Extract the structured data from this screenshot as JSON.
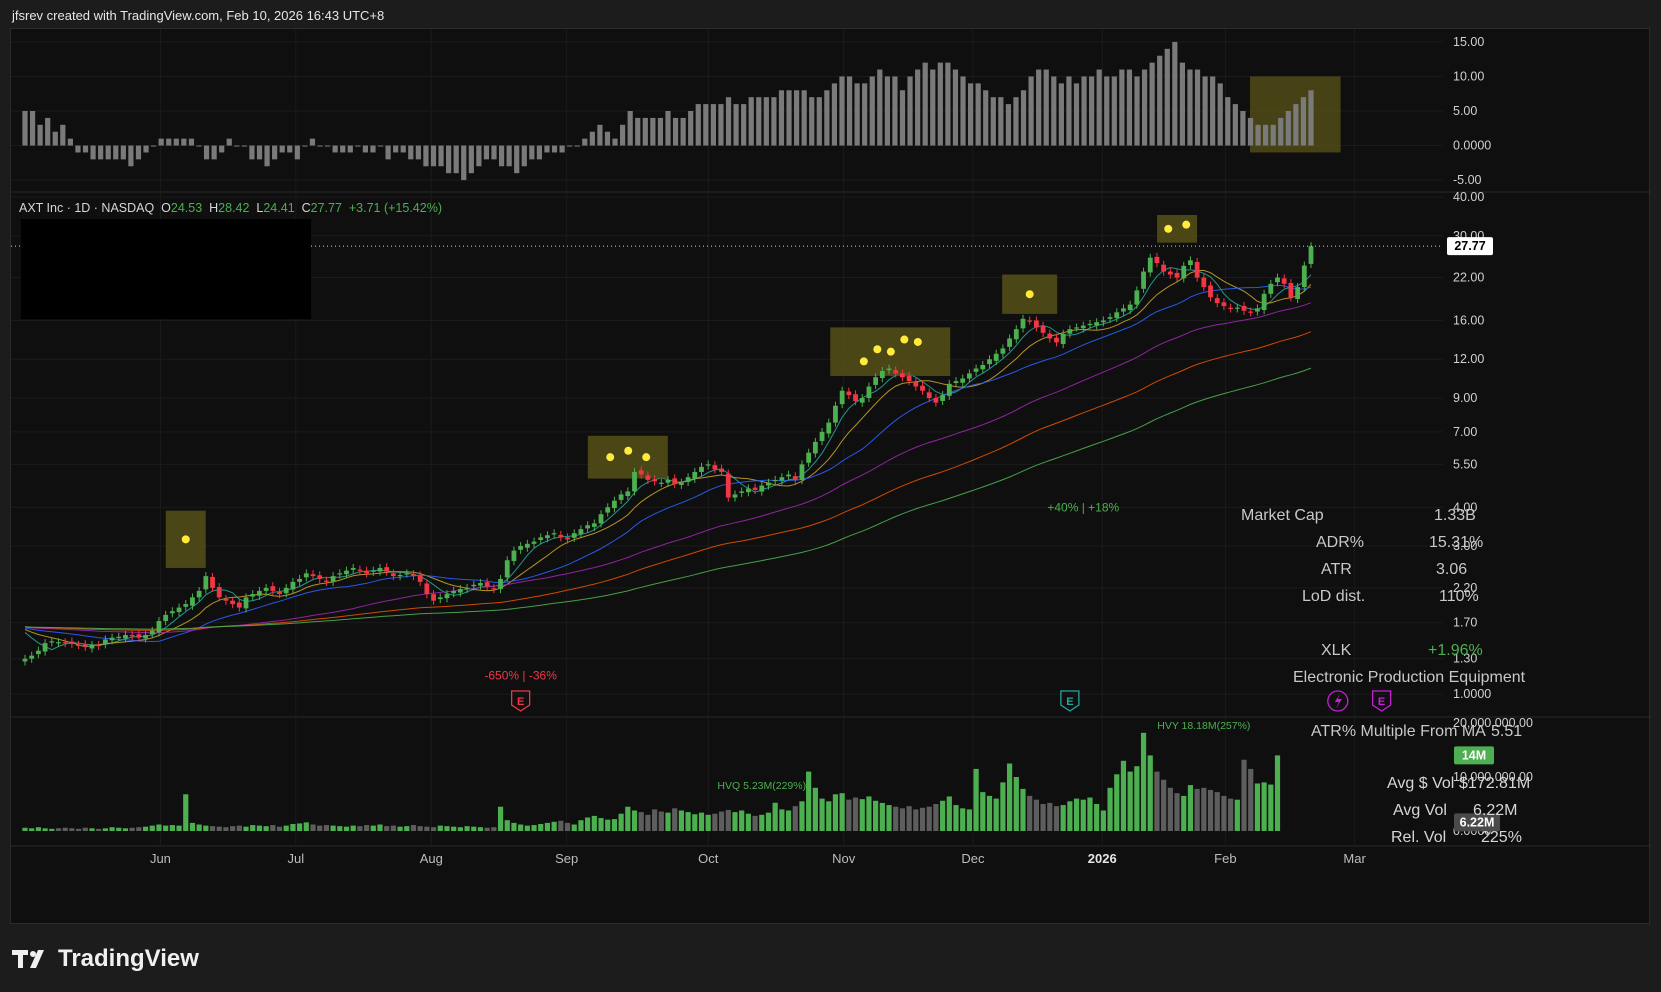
{
  "header": {
    "created_line": "jfsrev created with TradingView.com, Feb 10, 2026 16:43 UTC+8"
  },
  "brand": {
    "name": "TradingView"
  },
  "legend": {
    "symbol": "AXT Inc · 1D · NASDAQ",
    "open_label": "O",
    "open": "24.53",
    "high_label": "H",
    "high": "28.42",
    "low_label": "L",
    "low": "24.41",
    "close_label": "C",
    "close": "27.77",
    "change": "+3.71 (+15.42%)"
  },
  "last_price_tag": "27.77",
  "stats": {
    "market_cap_label": "Market Cap",
    "market_cap": "1.33B",
    "adr_label": "ADR%",
    "adr": "15.31%",
    "atr_label": "ATR",
    "atr": "3.06",
    "lod_label": "LoD dist.",
    "lod": "110%",
    "sector_etf_label": "XLK",
    "sector_etf_change": "+1.96%",
    "industry": "Electronic Production Equipment",
    "atr_multiple_label": "ATR% Multiple From MA",
    "atr_multiple": "5.51"
  },
  "volume_stats": {
    "avg_dollar_vol_label": "Avg $ Vol",
    "avg_dollar_vol": "$172.81M",
    "avg_vol_label": "Avg Vol",
    "avg_vol": "6.22M",
    "rel_vol_label": "Rel. Vol",
    "rel_vol": "225%",
    "tag_green": "14M",
    "tag_gray": "6.22M"
  },
  "annotations": {
    "earnings_neg": "-650% | -36%",
    "earnings_pos": "+40% | +18%",
    "hvq": "HVQ 5.23M(229%)",
    "hvy": "HVY 18.18M(257%)"
  },
  "colors": {
    "up": "#4caf50",
    "down": "#f23645",
    "background": "#0f0f0f",
    "highlight": "#5a5418",
    "dot": "#ffeb3b",
    "ma_fast": "#26a69a",
    "ma_10": "#c9a227",
    "ma_21": "#2962ff",
    "ma_50": "#9c27b0",
    "ma_100": "#e65100",
    "ma_200": "#4caf50"
  },
  "chart_data": [
    {
      "type": "bar",
      "title": "",
      "yticks": [
        "15.00",
        "10.00",
        "5.00",
        "0.0000",
        "-5.00"
      ],
      "ylim": [
        -6,
        16
      ],
      "values": [
        5,
        5,
        3,
        4,
        2,
        3,
        1,
        -1,
        -1,
        -2,
        -2,
        -2,
        -2,
        -2,
        -3,
        -2,
        -1,
        0,
        1,
        1,
        1,
        1,
        1,
        0,
        -2,
        -2,
        -1,
        1,
        0,
        0,
        -2,
        -2,
        -3,
        -2,
        -1,
        -1,
        -2,
        0,
        1,
        0,
        0,
        -1,
        -1,
        -1,
        0,
        -1,
        -1,
        0,
        -2,
        -1,
        -1,
        -2,
        -2,
        -3,
        -3,
        -3,
        -4,
        -4,
        -5,
        -4,
        -3,
        -2,
        -2,
        -3,
        -3,
        -4,
        -3,
        -2,
        -2,
        -1,
        -1,
        -1,
        0,
        0,
        1,
        2,
        3,
        2,
        1,
        3,
        5,
        4,
        4,
        4,
        4,
        5,
        4,
        4,
        5,
        6,
        6,
        6,
        6,
        7,
        6,
        6,
        7,
        7,
        7,
        7,
        8,
        8,
        8,
        8,
        7,
        7,
        8,
        9,
        10,
        10,
        9,
        9,
        10,
        11,
        10,
        10,
        8,
        10,
        11,
        12,
        11,
        12,
        12,
        11,
        10,
        9,
        9,
        8,
        7,
        7,
        6,
        7,
        8,
        10,
        11,
        11,
        10,
        9,
        10,
        9,
        10,
        10,
        11,
        10,
        10,
        11,
        11,
        10,
        11,
        12,
        13,
        14,
        15,
        12,
        11,
        11,
        10,
        10,
        9,
        7,
        6,
        5,
        4,
        3,
        3,
        3,
        4,
        5,
        6,
        7,
        8
      ],
      "highlight_last": 8
    },
    {
      "type": "candlestick",
      "title": "AXT Inc · 1D · NASDAQ",
      "xticks": [
        "Jun",
        "Jul",
        "Aug",
        "Sep",
        "Oct",
        "Nov",
        "Dec",
        "2026",
        "Feb",
        "Mar"
      ],
      "yticks": [
        "40.00",
        "30.00",
        "22.00",
        "16.00",
        "12.00",
        "9.00",
        "7.00",
        "5.50",
        "4.00",
        "3.00",
        "2.20",
        "1.70",
        "1.30",
        "1.0000"
      ],
      "yscale": "log",
      "ylim": [
        0.95,
        40
      ],
      "closes": [
        1.3,
        1.33,
        1.38,
        1.46,
        1.48,
        1.47,
        1.46,
        1.45,
        1.44,
        1.42,
        1.44,
        1.43,
        1.5,
        1.52,
        1.53,
        1.55,
        1.54,
        1.52,
        1.55,
        1.6,
        1.72,
        1.8,
        1.85,
        1.9,
        1.95,
        2.05,
        2.15,
        2.4,
        2.2,
        2.05,
        2.0,
        1.95,
        1.9,
        2.05,
        2.1,
        2.15,
        2.2,
        2.15,
        2.1,
        2.2,
        2.3,
        2.35,
        2.45,
        2.4,
        2.35,
        2.3,
        2.4,
        2.45,
        2.5,
        2.55,
        2.5,
        2.45,
        2.5,
        2.55,
        2.48,
        2.4,
        2.42,
        2.45,
        2.4,
        2.3,
        2.1,
        2.0,
        2.05,
        2.1,
        2.15,
        2.18,
        2.2,
        2.25,
        2.28,
        2.22,
        2.18,
        2.35,
        2.7,
        2.9,
        3.0,
        3.05,
        3.1,
        3.2,
        3.25,
        3.3,
        3.2,
        3.15,
        3.3,
        3.4,
        3.5,
        3.55,
        3.8,
        4.0,
        4.2,
        4.4,
        4.5,
        5.2,
        5.1,
        4.9,
        4.85,
        4.8,
        4.9,
        4.75,
        4.8,
        5.0,
        5.2,
        5.4,
        5.5,
        5.3,
        5.2,
        4.3,
        4.4,
        4.5,
        4.6,
        4.55,
        4.7,
        4.8,
        4.9,
        5.0,
        5.1,
        4.9,
        5.5,
        6.0,
        6.5,
        7.0,
        7.5,
        8.5,
        9.5,
        9.2,
        8.8,
        9.0,
        9.8,
        10.5,
        11.0,
        11.2,
        10.8,
        10.5,
        10.2,
        9.8,
        9.5,
        9.0,
        8.7,
        9.2,
        10.0,
        10.2,
        10.4,
        10.8,
        11.2,
        11.5,
        12.0,
        12.5,
        13.0,
        14.0,
        15.0,
        16.2,
        16.0,
        15.2,
        14.6,
        14.0,
        13.6,
        14.5,
        15.0,
        15.2,
        15.4,
        15.6,
        15.8,
        16.0,
        16.4,
        17.0,
        17.5,
        18.0,
        20.0,
        23.0,
        25.5,
        24.5,
        23.0,
        22.5,
        22.0,
        24.0,
        25.0,
        22.0,
        20.5,
        19.0,
        18.2,
        17.8,
        17.5,
        17.6,
        17.2,
        17.0,
        17.5,
        19.5,
        21.0,
        22.0,
        21.0,
        19.0,
        20.5,
        24.06,
        27.77
      ],
      "moving_averages": [
        "10",
        "21",
        "50",
        "100",
        "200"
      ]
    },
    {
      "type": "bar",
      "title": "",
      "yticks": [
        "20,000,000.00",
        "10,000,000.00",
        "0.0000"
      ],
      "ylim": [
        0,
        20000000
      ],
      "values": [
        0.6,
        0.5,
        0.7,
        0.5,
        0.4,
        0.5,
        0.6,
        0.5,
        0.4,
        0.6,
        0.5,
        0.4,
        0.5,
        0.7,
        0.6,
        0.5,
        0.6,
        0.7,
        0.8,
        1.0,
        1.2,
        1.0,
        1.1,
        1.0,
        6.8,
        1.5,
        1.2,
        1.0,
        0.9,
        0.8,
        0.7,
        0.9,
        1.0,
        0.8,
        1.1,
        1.0,
        0.9,
        1.1,
        0.8,
        1.0,
        1.3,
        1.4,
        1.6,
        1.2,
        1.0,
        1.1,
        1.0,
        0.9,
        0.8,
        1.0,
        0.9,
        1.1,
        1.0,
        1.2,
        0.9,
        1.0,
        0.8,
        0.9,
        1.1,
        0.9,
        0.8,
        0.7,
        1.0,
        0.9,
        0.8,
        0.7,
        0.9,
        0.8,
        0.7,
        0.6,
        0.7,
        4.5,
        2.0,
        1.5,
        1.2,
        1.0,
        1.1,
        1.3,
        1.5,
        1.7,
        1.9,
        1.5,
        1.2,
        2.0,
        2.5,
        2.8,
        2.4,
        2.1,
        2.2,
        3.2,
        4.5,
        3.8,
        3.5,
        3.0,
        4.0,
        3.6,
        3.4,
        4.2,
        3.8,
        3.5,
        3.1,
        3.4,
        3.0,
        3.2,
        3.6,
        3.9,
        3.5,
        3.8,
        3.2,
        2.8,
        3.0,
        3.4,
        5.23,
        4.0,
        3.8,
        4.6,
        5.5,
        11.0,
        8.0,
        6.0,
        5.5,
        6.8,
        7.0,
        5.8,
        6.2,
        5.9,
        6.4,
        5.6,
        5.2,
        4.8,
        4.5,
        4.2,
        4.6,
        4.0,
        4.3,
        4.5,
        5.0,
        5.6,
        6.4,
        4.8,
        4.2,
        4.0,
        11.5,
        7.2,
        6.5,
        6.0,
        9.0,
        12.5,
        10.0,
        7.8,
        6.5,
        5.8,
        5.0,
        5.2,
        4.6,
        4.8,
        5.5,
        6.0,
        5.8,
        6.2,
        5.0,
        3.8,
        8.0,
        10.5,
        13.0,
        11.0,
        12.0,
        18.18,
        14.0,
        11.0,
        9.5,
        8.0,
        7.0,
        6.5,
        8.5,
        7.8,
        8.0,
        7.6,
        7.2,
        6.5,
        6.0,
        5.8,
        13.2,
        11.5,
        8.8,
        9.0,
        8.6,
        14.0
      ],
      "units": "millions"
    }
  ]
}
